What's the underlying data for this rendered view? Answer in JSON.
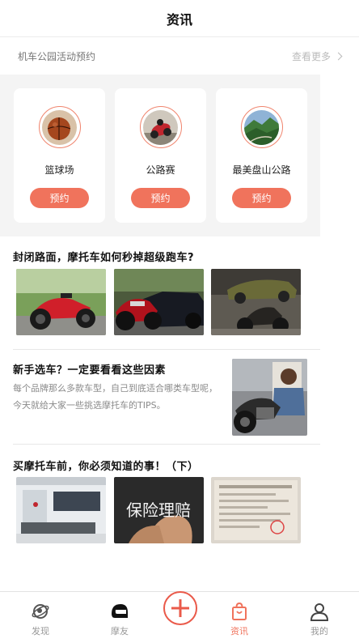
{
  "header": {
    "title": "资讯"
  },
  "section": {
    "label": "机车公园活动预约",
    "more": "查看更多"
  },
  "venues": [
    {
      "name": "篮球场",
      "button": "预约"
    },
    {
      "name": "公路赛",
      "button": "预约"
    },
    {
      "name": "最美盘山公路",
      "button": "预约"
    }
  ],
  "articles": [
    {
      "title": "封闭路面，摩托车如何秒掉超级跑车?"
    },
    {
      "title": "新手选车？一定要看看这些因素",
      "description": "每个品牌那么多款车型，自己到底适合哪类车型呢，今天就给大家一些挑选摩托车的TIPS。"
    },
    {
      "title": "买摩托车前，你必须知道的事！（下）",
      "thumb_text": "保险理赔"
    }
  ],
  "tabbar": {
    "items": [
      {
        "label": "发现",
        "icon": "planet-icon"
      },
      {
        "label": "摩友",
        "icon": "helmet-icon"
      },
      {
        "label": "",
        "icon": "plus-icon"
      },
      {
        "label": "资讯",
        "icon": "bag-icon"
      },
      {
        "label": "我的",
        "icon": "user-icon"
      }
    ],
    "active": "资讯"
  },
  "colors": {
    "accent": "#f0735c",
    "plus": "#ea5a4a",
    "panel_bg": "#f4f4f4"
  }
}
